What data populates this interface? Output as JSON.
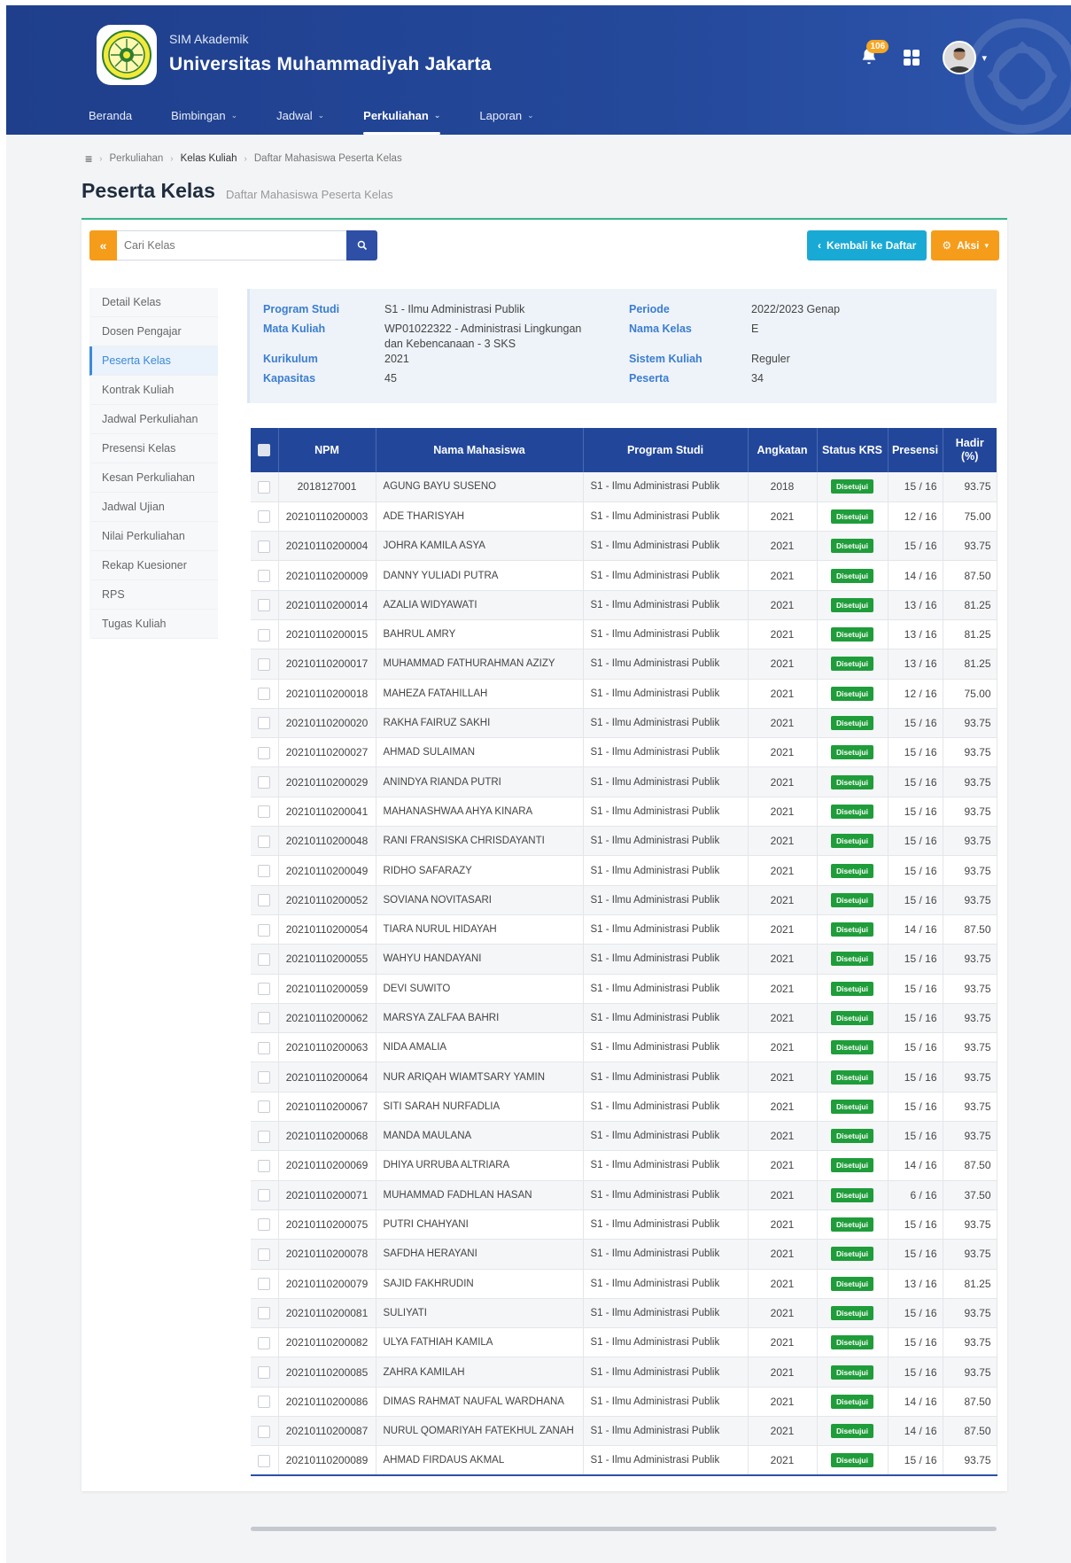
{
  "app": {
    "subtitle": "SIM Akademik",
    "title": "Universitas Muhammadiyah Jakarta",
    "notification_count": "106"
  },
  "nav": [
    {
      "label": "Beranda",
      "dropdown": false,
      "active": false
    },
    {
      "label": "Bimbingan",
      "dropdown": true,
      "active": false
    },
    {
      "label": "Jadwal",
      "dropdown": true,
      "active": false
    },
    {
      "label": "Perkuliahan",
      "dropdown": true,
      "active": true
    },
    {
      "label": "Laporan",
      "dropdown": true,
      "active": false
    }
  ],
  "breadcrumb": [
    "Perkuliahan",
    "Kelas Kuliah",
    "Daftar Mahasiswa Peserta Kelas"
  ],
  "page": {
    "title": "Peserta Kelas",
    "subtitle": "Daftar Mahasiswa Peserta Kelas"
  },
  "search": {
    "placeholder": "Cari Kelas",
    "back_icon": "double-chevron-left-icon",
    "go_icon": "search-icon"
  },
  "actions": {
    "back_label": "Kembali ke Daftar",
    "aksi_label": "Aksi"
  },
  "sidebar": [
    {
      "label": "Detail Kelas",
      "active": false
    },
    {
      "label": "Dosen Pengajar",
      "active": false
    },
    {
      "label": "Peserta Kelas",
      "active": true
    },
    {
      "label": "Kontrak Kuliah",
      "active": false
    },
    {
      "label": "Jadwal Perkuliahan",
      "active": false
    },
    {
      "label": "Presensi Kelas",
      "active": false
    },
    {
      "label": "Kesan Perkuliahan",
      "active": false
    },
    {
      "label": "Jadwal Ujian",
      "active": false
    },
    {
      "label": "Nilai Perkuliahan",
      "active": false
    },
    {
      "label": "Rekap Kuesioner",
      "active": false
    },
    {
      "label": "RPS",
      "active": false
    },
    {
      "label": "Tugas Kuliah",
      "active": false
    }
  ],
  "info": {
    "program_studi_label": "Program Studi",
    "program_studi": "S1 - Ilmu Administrasi Publik",
    "mata_kuliah_label": "Mata Kuliah",
    "mata_kuliah_line1": "WP01022322 - Administrasi Lingkungan",
    "mata_kuliah_line2": "dan Kebencanaan - 3 SKS",
    "kurikulum_label": "Kurikulum",
    "kurikulum": "2021",
    "kapasitas_label": "Kapasitas",
    "kapasitas": "45",
    "periode_label": "Periode",
    "periode": "2022/2023 Genap",
    "nama_kelas_label": "Nama Kelas",
    "nama_kelas": "E",
    "sistem_kuliah_label": "Sistem Kuliah",
    "sistem_kuliah": "Reguler",
    "peserta_label": "Peserta",
    "peserta": "34"
  },
  "table": {
    "headers": [
      "NPM",
      "Nama Mahasiswa",
      "Program Studi",
      "Angkatan",
      "Status KRS",
      "Presensi",
      "Hadir (%)"
    ],
    "status_color": "#1f9d3a",
    "rows": [
      {
        "npm": "2018127001",
        "nama": "AGUNG BAYU SUSENO",
        "prodi": "S1 - Ilmu Administrasi Publik",
        "angkatan": "2018",
        "status": "Disetujui",
        "presensi": "15 / 16",
        "hadir": "93.75"
      },
      {
        "npm": "20210110200003",
        "nama": "ADE THARISYAH",
        "prodi": "S1 - Ilmu Administrasi Publik",
        "angkatan": "2021",
        "status": "Disetujui",
        "presensi": "12 / 16",
        "hadir": "75.00"
      },
      {
        "npm": "20210110200004",
        "nama": "JOHRA KAMILA ASYA",
        "prodi": "S1 - Ilmu Administrasi Publik",
        "angkatan": "2021",
        "status": "Disetujui",
        "presensi": "15 / 16",
        "hadir": "93.75"
      },
      {
        "npm": "20210110200009",
        "nama": "DANNY YULIADI PUTRA",
        "prodi": "S1 - Ilmu Administrasi Publik",
        "angkatan": "2021",
        "status": "Disetujui",
        "presensi": "14 / 16",
        "hadir": "87.50"
      },
      {
        "npm": "20210110200014",
        "nama": "AZALIA WIDYAWATI",
        "prodi": "S1 - Ilmu Administrasi Publik",
        "angkatan": "2021",
        "status": "Disetujui",
        "presensi": "13 / 16",
        "hadir": "81.25"
      },
      {
        "npm": "20210110200015",
        "nama": "BAHRUL AMRY",
        "prodi": "S1 - Ilmu Administrasi Publik",
        "angkatan": "2021",
        "status": "Disetujui",
        "presensi": "13 / 16",
        "hadir": "81.25"
      },
      {
        "npm": "20210110200017",
        "nama": "MUHAMMAD FATHURAHMAN AZIZY",
        "prodi": "S1 - Ilmu Administrasi Publik",
        "angkatan": "2021",
        "status": "Disetujui",
        "presensi": "13 / 16",
        "hadir": "81.25"
      },
      {
        "npm": "20210110200018",
        "nama": "MAHEZA FATAHILLAH",
        "prodi": "S1 - Ilmu Administrasi Publik",
        "angkatan": "2021",
        "status": "Disetujui",
        "presensi": "12 / 16",
        "hadir": "75.00"
      },
      {
        "npm": "20210110200020",
        "nama": "RAKHA FAIRUZ SAKHI",
        "prodi": "S1 - Ilmu Administrasi Publik",
        "angkatan": "2021",
        "status": "Disetujui",
        "presensi": "15 / 16",
        "hadir": "93.75"
      },
      {
        "npm": "20210110200027",
        "nama": "AHMAD SULAIMAN",
        "prodi": "S1 - Ilmu Administrasi Publik",
        "angkatan": "2021",
        "status": "Disetujui",
        "presensi": "15 / 16",
        "hadir": "93.75"
      },
      {
        "npm": "20210110200029",
        "nama": "ANINDYA RIANDA PUTRI",
        "prodi": "S1 - Ilmu Administrasi Publik",
        "angkatan": "2021",
        "status": "Disetujui",
        "presensi": "15 / 16",
        "hadir": "93.75"
      },
      {
        "npm": "20210110200041",
        "nama": "MAHANASHWAA AHYA KINARA",
        "prodi": "S1 - Ilmu Administrasi Publik",
        "angkatan": "2021",
        "status": "Disetujui",
        "presensi": "15 / 16",
        "hadir": "93.75"
      },
      {
        "npm": "20210110200048",
        "nama": "RANI FRANSISKA CHRISDAYANTI",
        "prodi": "S1 - Ilmu Administrasi Publik",
        "angkatan": "2021",
        "status": "Disetujui",
        "presensi": "15 / 16",
        "hadir": "93.75"
      },
      {
        "npm": "20210110200049",
        "nama": "RIDHO SAFARAZY",
        "prodi": "S1 - Ilmu Administrasi Publik",
        "angkatan": "2021",
        "status": "Disetujui",
        "presensi": "15 / 16",
        "hadir": "93.75"
      },
      {
        "npm": "20210110200052",
        "nama": "SOVIANA NOVITASARI",
        "prodi": "S1 - Ilmu Administrasi Publik",
        "angkatan": "2021",
        "status": "Disetujui",
        "presensi": "15 / 16",
        "hadir": "93.75"
      },
      {
        "npm": "20210110200054",
        "nama": "TIARA NURUL HIDAYAH",
        "prodi": "S1 - Ilmu Administrasi Publik",
        "angkatan": "2021",
        "status": "Disetujui",
        "presensi": "14 / 16",
        "hadir": "87.50"
      },
      {
        "npm": "20210110200055",
        "nama": "WAHYU HANDAYANI",
        "prodi": "S1 - Ilmu Administrasi Publik",
        "angkatan": "2021",
        "status": "Disetujui",
        "presensi": "15 / 16",
        "hadir": "93.75"
      },
      {
        "npm": "20210110200059",
        "nama": "DEVI SUWITO",
        "prodi": "S1 - Ilmu Administrasi Publik",
        "angkatan": "2021",
        "status": "Disetujui",
        "presensi": "15 / 16",
        "hadir": "93.75"
      },
      {
        "npm": "20210110200062",
        "nama": "MARSYA ZALFAA BAHRI",
        "prodi": "S1 - Ilmu Administrasi Publik",
        "angkatan": "2021",
        "status": "Disetujui",
        "presensi": "15 / 16",
        "hadir": "93.75"
      },
      {
        "npm": "20210110200063",
        "nama": "NIDA AMALIA",
        "prodi": "S1 - Ilmu Administrasi Publik",
        "angkatan": "2021",
        "status": "Disetujui",
        "presensi": "15 / 16",
        "hadir": "93.75"
      },
      {
        "npm": "20210110200064",
        "nama": "NUR ARIQAH WIAMTSARY YAMIN",
        "prodi": "S1 - Ilmu Administrasi Publik",
        "angkatan": "2021",
        "status": "Disetujui",
        "presensi": "15 / 16",
        "hadir": "93.75"
      },
      {
        "npm": "20210110200067",
        "nama": "SITI SARAH NURFADLIA",
        "prodi": "S1 - Ilmu Administrasi Publik",
        "angkatan": "2021",
        "status": "Disetujui",
        "presensi": "15 / 16",
        "hadir": "93.75"
      },
      {
        "npm": "20210110200068",
        "nama": "MANDA MAULANA",
        "prodi": "S1 - Ilmu Administrasi Publik",
        "angkatan": "2021",
        "status": "Disetujui",
        "presensi": "15 / 16",
        "hadir": "93.75"
      },
      {
        "npm": "20210110200069",
        "nama": "DHIYA URRUBA ALTRIARA",
        "prodi": "S1 - Ilmu Administrasi Publik",
        "angkatan": "2021",
        "status": "Disetujui",
        "presensi": "14 / 16",
        "hadir": "87.50"
      },
      {
        "npm": "20210110200071",
        "nama": "MUHAMMAD FADHLAN HASAN",
        "prodi": "S1 - Ilmu Administrasi Publik",
        "angkatan": "2021",
        "status": "Disetujui",
        "presensi": "6 / 16",
        "hadir": "37.50"
      },
      {
        "npm": "20210110200075",
        "nama": "PUTRI CHAHYANI",
        "prodi": "S1 - Ilmu Administrasi Publik",
        "angkatan": "2021",
        "status": "Disetujui",
        "presensi": "15 / 16",
        "hadir": "93.75"
      },
      {
        "npm": "20210110200078",
        "nama": "SAFDHA HERAYANI",
        "prodi": "S1 - Ilmu Administrasi Publik",
        "angkatan": "2021",
        "status": "Disetujui",
        "presensi": "15 / 16",
        "hadir": "93.75"
      },
      {
        "npm": "20210110200079",
        "nama": "SAJID FAKHRUDIN",
        "prodi": "S1 - Ilmu Administrasi Publik",
        "angkatan": "2021",
        "status": "Disetujui",
        "presensi": "13 / 16",
        "hadir": "81.25"
      },
      {
        "npm": "20210110200081",
        "nama": "SULIYATI",
        "prodi": "S1 - Ilmu Administrasi Publik",
        "angkatan": "2021",
        "status": "Disetujui",
        "presensi": "15 / 16",
        "hadir": "93.75"
      },
      {
        "npm": "20210110200082",
        "nama": "ULYA FATHIAH KAMILA",
        "prodi": "S1 - Ilmu Administrasi Publik",
        "angkatan": "2021",
        "status": "Disetujui",
        "presensi": "15 / 16",
        "hadir": "93.75"
      },
      {
        "npm": "20210110200085",
        "nama": "ZAHRA KAMILAH",
        "prodi": "S1 - Ilmu Administrasi Publik",
        "angkatan": "2021",
        "status": "Disetujui",
        "presensi": "15 / 16",
        "hadir": "93.75"
      },
      {
        "npm": "20210110200086",
        "nama": "DIMAS RAHMAT NAUFAL WARDHANA",
        "prodi": "S1 - Ilmu Administrasi Publik",
        "angkatan": "2021",
        "status": "Disetujui",
        "presensi": "14 / 16",
        "hadir": "87.50"
      },
      {
        "npm": "20210110200087",
        "nama": "NURUL QOMARIYAH FATEKHUL ZANAH",
        "prodi": "S1 - Ilmu Administrasi Publik",
        "angkatan": "2021",
        "status": "Disetujui",
        "presensi": "14 / 16",
        "hadir": "87.50"
      },
      {
        "npm": "20210110200089",
        "nama": "AHMAD FIRDAUS AKMAL",
        "prodi": "S1 - Ilmu Administrasi Publik",
        "angkatan": "2021",
        "status": "Disetujui",
        "presensi": "15 / 16",
        "hadir": "93.75"
      }
    ]
  }
}
